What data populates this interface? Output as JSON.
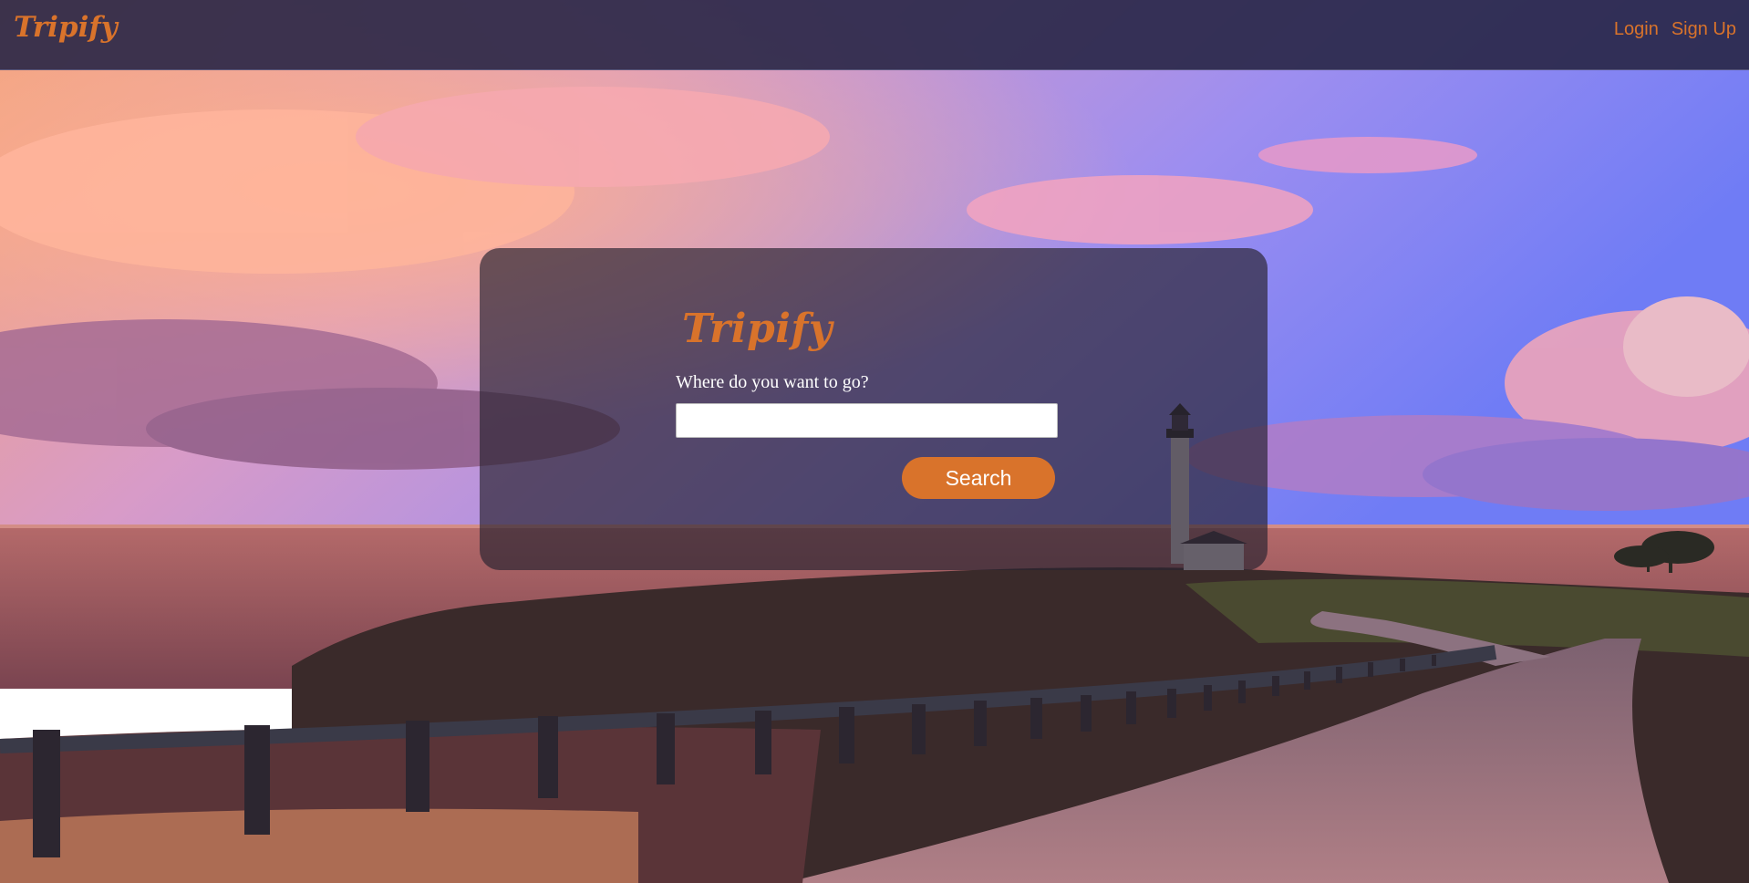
{
  "navbar": {
    "brand": "Tripify",
    "links": {
      "login": "Login",
      "signup": "Sign Up"
    }
  },
  "search_card": {
    "title": "Tripify",
    "prompt": "Where do you want to go?",
    "destination_value": "",
    "search_label": "Search"
  },
  "background": {
    "description_icon": "coastal-lighthouse-sunset-photo"
  },
  "colors": {
    "accent": "#d9732b",
    "navbar_bg": "#28264a",
    "card_bg": "#2a2430"
  }
}
